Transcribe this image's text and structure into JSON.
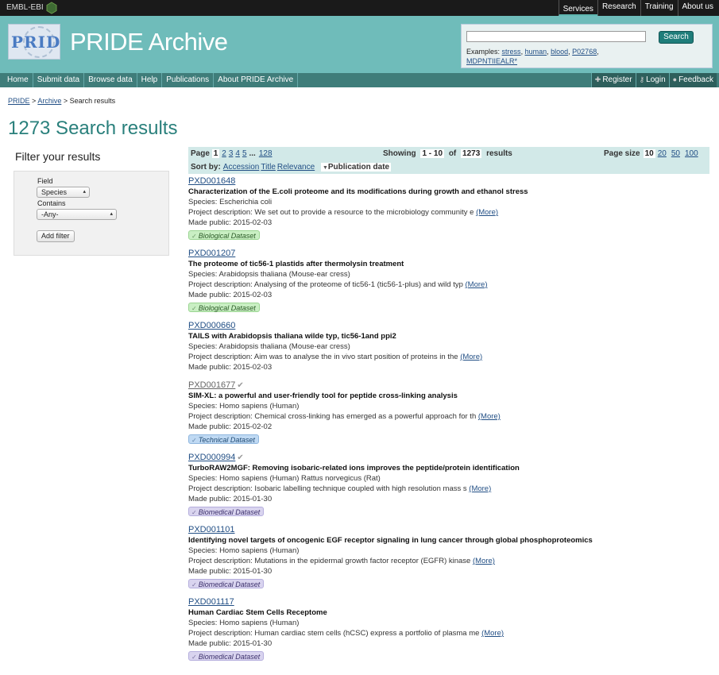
{
  "topbar": {
    "logo": "EMBL-EBI",
    "nav": [
      {
        "label": "Services",
        "active": true
      },
      {
        "label": "Research",
        "active": false
      },
      {
        "label": "Training",
        "active": false
      },
      {
        "label": "About us",
        "active": false
      }
    ]
  },
  "masthead": {
    "logo_text": "PRIDE",
    "title": "PRIDE Archive",
    "search": {
      "placeholder": "",
      "button": "Search",
      "examples_label": "Examples:",
      "examples": [
        "stress",
        "human",
        "blood",
        "P02768",
        "MDPNTIIEALR*"
      ]
    }
  },
  "main_nav": {
    "items": [
      "Home",
      "Submit data",
      "Browse data",
      "Help",
      "Publications",
      "About PRIDE Archive"
    ],
    "right": [
      "Register",
      "Login",
      "Feedback"
    ]
  },
  "breadcrumb": {
    "items": [
      "PRIDE",
      "Archive"
    ],
    "sep": ">",
    "current": "Search results"
  },
  "page_title": "1273 Search results",
  "filter": {
    "heading": "Filter your results",
    "field_label": "Field",
    "field_value": "Species",
    "contains_label": "Contains",
    "contains_value": "-Any-",
    "add_button": "Add filter"
  },
  "results_header": {
    "page_label": "Page",
    "pages": [
      "1",
      "2",
      "3",
      "4",
      "5",
      "...",
      "128"
    ],
    "current_page": "1",
    "showing_label": "Showing",
    "showing_range": "1 - 10",
    "of_label": "of",
    "total": "1273",
    "results_label": "results",
    "page_size_label": "Page size",
    "page_sizes": [
      "10",
      "20",
      "50",
      "100"
    ],
    "current_page_size": "10",
    "sort_label": "Sort by:",
    "sort_options": [
      "Accession",
      "Title",
      "Relevance"
    ],
    "sort_active": "Publication date"
  },
  "results": [
    {
      "accession": "PXD001648",
      "title": "Characterization of the E.coli proteome and its modifications during growth and ethanol stress",
      "species": "Species: Escherichia coli",
      "description": "Project description: We set out to provide a resource to the microbiology community e",
      "more": "(More)",
      "made_public": "Made public: 2015-02-03",
      "badge": "Biological Dataset",
      "badge_type": "bio"
    },
    {
      "accession": "PXD001207",
      "title": "The proteome of tic56-1 plastids after thermolysin treatment",
      "species": "Species: Arabidopsis thaliana (Mouse-ear cress)",
      "description": "Project description: Analysing of the proteome of tic56-1 (tic56-1-plus) and wild typ",
      "more": "(More)",
      "made_public": "Made public: 2015-02-03",
      "badge": "Biological Dataset",
      "badge_type": "bio"
    },
    {
      "accession": "PXD000660",
      "title": "TAILS with Arabidopsis thaliana wilde typ, tic56-1and ppi2",
      "species": "Species: Arabidopsis thaliana (Mouse-ear cress)",
      "description": "Project description: Aim was to analyse the in vivo start position of proteins in the",
      "more": "(More)",
      "made_public": "Made public: 2015-02-03",
      "badge": "",
      "badge_type": ""
    },
    {
      "accession": "PXD001677",
      "title": "SIM-XL: a powerful and user-friendly tool for peptide cross-linking analysis",
      "species": "Species: Homo sapiens (Human)",
      "description": "Project description: Chemical cross-linking has emerged as a powerful approach for th",
      "more": "(More)",
      "made_public": "Made public: 2015-02-02",
      "badge": "Technical Dataset",
      "badge_type": "tech"
    },
    {
      "accession": "PXD000994",
      "title": "TurboRAW2MGF: Removing isobaric-related ions improves the peptide/protein identification",
      "species": "Species: Homo sapiens (Human) Rattus norvegicus (Rat)",
      "description": "Project description: Isobaric labelling technique coupled with high resolution mass s",
      "more": "(More)",
      "made_public": "Made public: 2015-01-30",
      "badge": "Biomedical Dataset",
      "badge_type": "biomed"
    },
    {
      "accession": "PXD001101",
      "title": "Identifying novel targets of oncogenic EGF receptor signaling in lung cancer through global phosphoproteomics",
      "species": "Species: Homo sapiens (Human)",
      "description": "Project description: Mutations in the epidermal growth factor receptor (EGFR) kinase",
      "more": "(More)",
      "made_public": "Made public: 2015-01-30",
      "badge": "Biomedical Dataset",
      "badge_type": "biomed"
    },
    {
      "accession": "PXD001117",
      "title": "Human Cardiac Stem Cells Receptome",
      "species": "Species: Homo sapiens (Human)",
      "description": "Project description: Human cardiac stem cells (hCSC) express a portfolio of plasma me",
      "more": "(More)",
      "made_public": "Made public: 2015-01-30",
      "badge": "Biomedical Dataset",
      "badge_type": "biomed"
    }
  ]
}
